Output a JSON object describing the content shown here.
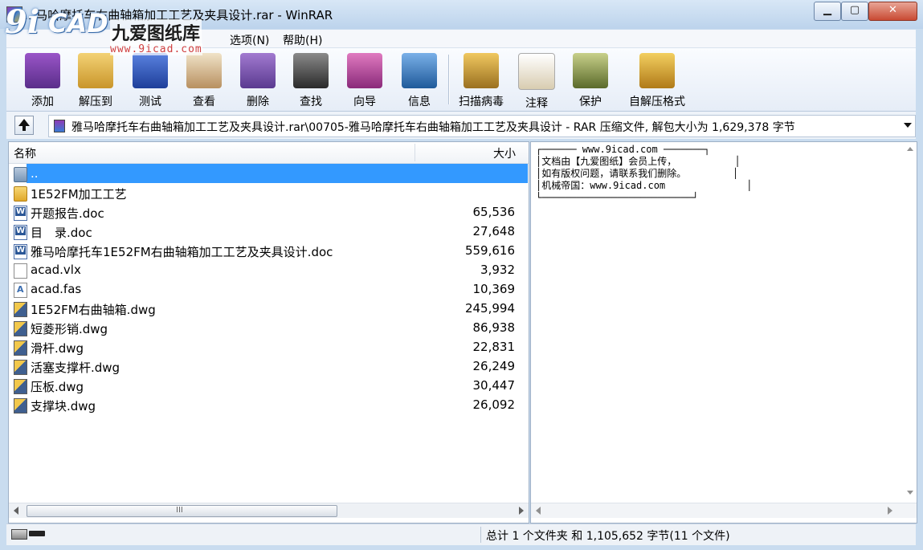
{
  "window": {
    "title": "...马哈摩托车右曲轴箱加工工艺及夹具设计.rar - WinRAR",
    "min_label": "▁",
    "max_label": "▢",
    "close_label": "✕"
  },
  "logo": {
    "mark_9": "9i",
    "mark_cad": "CAD",
    "cn": "九爱图纸库",
    "url": "www.9icad.com"
  },
  "menu": [
    {
      "label": "选项(N)"
    },
    {
      "label": "帮助(H)"
    }
  ],
  "toolbar": [
    {
      "label": "添加",
      "icon": "add-archive-icon",
      "color": "#7a3fb0"
    },
    {
      "label": "解压到",
      "icon": "extract-to-icon",
      "color": "#e2b43a"
    },
    {
      "label": "测试",
      "icon": "test-icon",
      "color": "#2a55c0"
    },
    {
      "label": "查看",
      "icon": "view-icon",
      "color": "#c9a36a"
    },
    {
      "label": "删除",
      "icon": "delete-icon",
      "color": "#6a4aa0"
    },
    {
      "label": "查找",
      "icon": "find-icon",
      "color": "#4a4a4a"
    },
    {
      "label": "向导",
      "icon": "wizard-icon",
      "color": "#a03a8a"
    },
    {
      "label": "信息",
      "icon": "info-icon",
      "color": "#2e6fb5"
    },
    {
      "label": "扫描病毒",
      "icon": "scan-virus-icon",
      "color": "#c89a2a"
    },
    {
      "label": "注释",
      "icon": "comment-icon",
      "color": "#e8e0c8"
    },
    {
      "label": "保护",
      "icon": "protect-icon",
      "color": "#7a8a4a"
    },
    {
      "label": "自解压格式",
      "icon": "sfx-icon",
      "color": "#d8a030"
    }
  ],
  "address": {
    "text": "雅马哈摩托车右曲轴箱加工工艺及夹具设计.rar\\00705-雅马哈摩托车右曲轴箱加工工艺及夹具设计 - RAR 压缩文件, 解包大小为 1,629,378 字节"
  },
  "list": {
    "col_name": "名称",
    "col_size": "大小",
    "rows": [
      {
        "name": "..",
        "size": "",
        "type": "folder-up",
        "selected": true
      },
      {
        "name": "1E52FM加工工艺",
        "size": "",
        "type": "folder"
      },
      {
        "name": "开题报告.doc",
        "size": "65,536",
        "type": "doc"
      },
      {
        "name": "目　录.doc",
        "size": "27,648",
        "type": "doc"
      },
      {
        "name": "雅马哈摩托车1E52FM右曲轴箱加工工艺及夹具设计.doc",
        "size": "559,616",
        "type": "doc"
      },
      {
        "name": "acad.vlx",
        "size": "3,932",
        "type": "file"
      },
      {
        "name": "acad.fas",
        "size": "10,369",
        "type": "fas"
      },
      {
        "name": "1E52FM右曲轴箱.dwg",
        "size": "245,994",
        "type": "dwg"
      },
      {
        "name": "短菱形销.dwg",
        "size": "86,938",
        "type": "dwg"
      },
      {
        "name": "滑杆.dwg",
        "size": "22,831",
        "type": "dwg"
      },
      {
        "name": "活塞支撑杆.dwg",
        "size": "26,249",
        "type": "dwg"
      },
      {
        "name": "压板.dwg",
        "size": "30,447",
        "type": "dwg"
      },
      {
        "name": "支撑块.dwg",
        "size": "26,092",
        "type": "dwg"
      }
    ],
    "hscroll_grip": "III"
  },
  "comment": {
    "text": "┌────── www.9icad.com ───────┐\n│文档由【九爱图纸】会员上传，          │\n│如有版权问题，请联系我们删除。        │\n│机械帝国：www.9icad.com              │\n└──────────────────────────┘"
  },
  "status": {
    "text": "总计 1 个文件夹 和 1,105,652 字节(11 个文件)"
  }
}
